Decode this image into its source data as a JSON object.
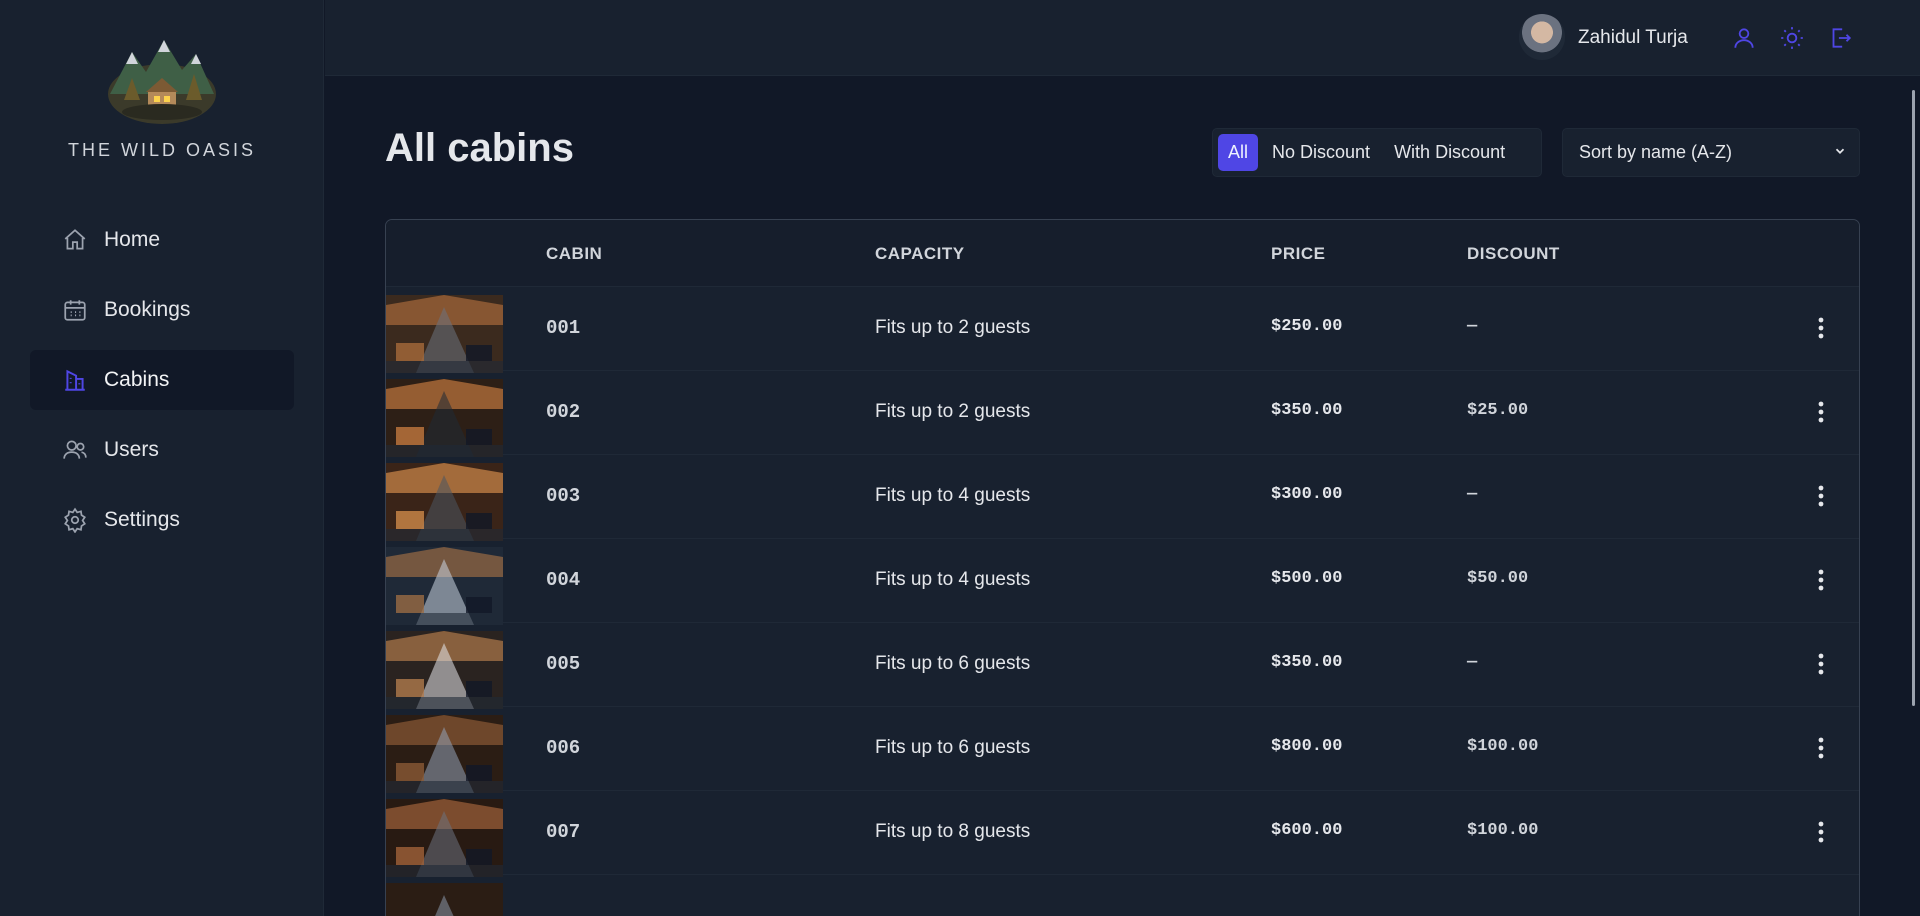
{
  "brand": {
    "name": "THE WILD OASIS"
  },
  "nav": {
    "items": [
      {
        "label": "Home",
        "icon": "home-icon",
        "active": false
      },
      {
        "label": "Bookings",
        "icon": "calendar-icon",
        "active": false
      },
      {
        "label": "Cabins",
        "icon": "buildings-icon",
        "active": true
      },
      {
        "label": "Users",
        "icon": "users-icon",
        "active": false
      },
      {
        "label": "Settings",
        "icon": "gear-icon",
        "active": false
      }
    ]
  },
  "header": {
    "user_name": "Zahidul Turja",
    "icons": [
      "user-icon",
      "sun-icon",
      "logout-icon"
    ]
  },
  "page": {
    "title": "All cabins",
    "filter": {
      "options": [
        "All",
        "No Discount",
        "With Discount"
      ],
      "selected": "All"
    },
    "sort": {
      "value": "Sort by name (A-Z)"
    }
  },
  "table": {
    "headers": [
      "CABIN",
      "CAPACITY",
      "PRICE",
      "DISCOUNT"
    ],
    "rows": [
      {
        "name": "001",
        "capacity": "Fits up to 2 guests",
        "price": "$250.00",
        "discount": "—"
      },
      {
        "name": "002",
        "capacity": "Fits up to 2 guests",
        "price": "$350.00",
        "discount": "$25.00"
      },
      {
        "name": "003",
        "capacity": "Fits up to 4 guests",
        "price": "$300.00",
        "discount": "—"
      },
      {
        "name": "004",
        "capacity": "Fits up to 4 guests",
        "price": "$500.00",
        "discount": "$50.00"
      },
      {
        "name": "005",
        "capacity": "Fits up to 6 guests",
        "price": "$350.00",
        "discount": "—"
      },
      {
        "name": "006",
        "capacity": "Fits up to 6 guests",
        "price": "$800.00",
        "discount": "$100.00"
      },
      {
        "name": "007",
        "capacity": "Fits up to 8 guests",
        "price": "$600.00",
        "discount": "$100.00"
      }
    ]
  },
  "colors": {
    "accent": "#4f46e5",
    "sidebar_bg": "#18212f",
    "page_bg": "#111827"
  }
}
